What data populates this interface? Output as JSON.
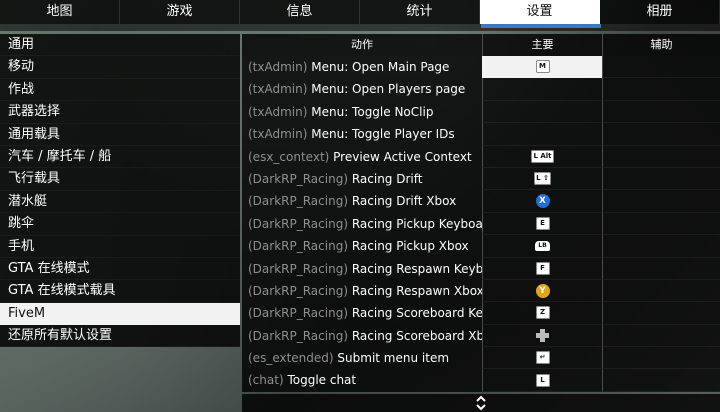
{
  "tabs": [
    {
      "label": "地图"
    },
    {
      "label": "游戏"
    },
    {
      "label": "信息"
    },
    {
      "label": "统计"
    },
    {
      "label": "设置",
      "active": true
    },
    {
      "label": "相册"
    }
  ],
  "sidebar": {
    "items": [
      {
        "label": "通用"
      },
      {
        "label": "移动"
      },
      {
        "label": "作战"
      },
      {
        "label": "武器选择"
      },
      {
        "label": "通用载具"
      },
      {
        "label": "汽车 / 摩托车 / 船"
      },
      {
        "label": "飞行载具"
      },
      {
        "label": "潜水艇"
      },
      {
        "label": "跳伞"
      },
      {
        "label": "手机"
      },
      {
        "label": "GTA 在线模式"
      },
      {
        "label": "GTA 在线模式载具"
      },
      {
        "label": "FiveM",
        "selected": true
      },
      {
        "label": "还原所有默认设置"
      }
    ]
  },
  "table": {
    "headers": {
      "action": "动作",
      "primary": "主要",
      "secondary": "辅助"
    },
    "rows": [
      {
        "resource": "(txAdmin)",
        "action": "Menu: Open Main Page",
        "primary": {
          "type": "key",
          "label": "M"
        },
        "icon": "keyboard-m-icon"
      },
      {
        "resource": "(txAdmin)",
        "action": "Menu: Open Players page",
        "primary": null
      },
      {
        "resource": "(txAdmin)",
        "action": "Menu: Toggle NoClip",
        "primary": null
      },
      {
        "resource": "(txAdmin)",
        "action": "Menu: Toggle Player IDs",
        "primary": null
      },
      {
        "resource": "(esx_context)",
        "action": "Preview Active Context",
        "primary": {
          "type": "key",
          "label": "L Alt"
        },
        "icon": "keyboard-left-alt-icon"
      },
      {
        "resource": "(DarkRP_Racing)",
        "action": "Racing Drift",
        "primary": {
          "type": "key",
          "label": "L ⇧"
        },
        "icon": "keyboard-left-shift-icon"
      },
      {
        "resource": "(DarkRP_Racing)",
        "action": "Racing Drift Xbox",
        "primary": {
          "type": "pad",
          "label": "X",
          "color": "#1f6fd6"
        },
        "icon": "xbox-x-button-icon"
      },
      {
        "resource": "(DarkRP_Racing)",
        "action": "Racing Pickup Keyboard",
        "primary": {
          "type": "key",
          "label": "E"
        },
        "icon": "keyboard-e-icon"
      },
      {
        "resource": "(DarkRP_Racing)",
        "action": "Racing Pickup Xbox",
        "primary": {
          "type": "lb",
          "label": "LB"
        },
        "icon": "xbox-lb-button-icon"
      },
      {
        "resource": "(DarkRP_Racing)",
        "action": "Racing Respawn Keyboard",
        "primary": {
          "type": "key",
          "label": "F"
        },
        "icon": "keyboard-f-icon"
      },
      {
        "resource": "(DarkRP_Racing)",
        "action": "Racing Respawn Xbox",
        "primary": {
          "type": "pad",
          "label": "Y",
          "color": "#e0a418"
        },
        "icon": "xbox-y-button-icon"
      },
      {
        "resource": "(DarkRP_Racing)",
        "action": "Racing Scoreboard Keyboard",
        "primary": {
          "type": "key",
          "label": "Z"
        },
        "icon": "keyboard-z-icon"
      },
      {
        "resource": "(DarkRP_Racing)",
        "action": "Racing Scoreboard Xbox",
        "primary": {
          "type": "dpad",
          "label": ""
        },
        "icon": "xbox-dpad-icon"
      },
      {
        "resource": "(es_extended)",
        "action": "Submit menu item",
        "primary": {
          "type": "key",
          "label": "↵"
        },
        "icon": "keyboard-enter-icon"
      },
      {
        "resource": "(chat)",
        "action": "Toggle chat",
        "primary": {
          "type": "key",
          "label": "L"
        },
        "icon": "keyboard-l-icon"
      }
    ]
  },
  "scroll": {
    "icon": "scroll-updown-icon"
  }
}
